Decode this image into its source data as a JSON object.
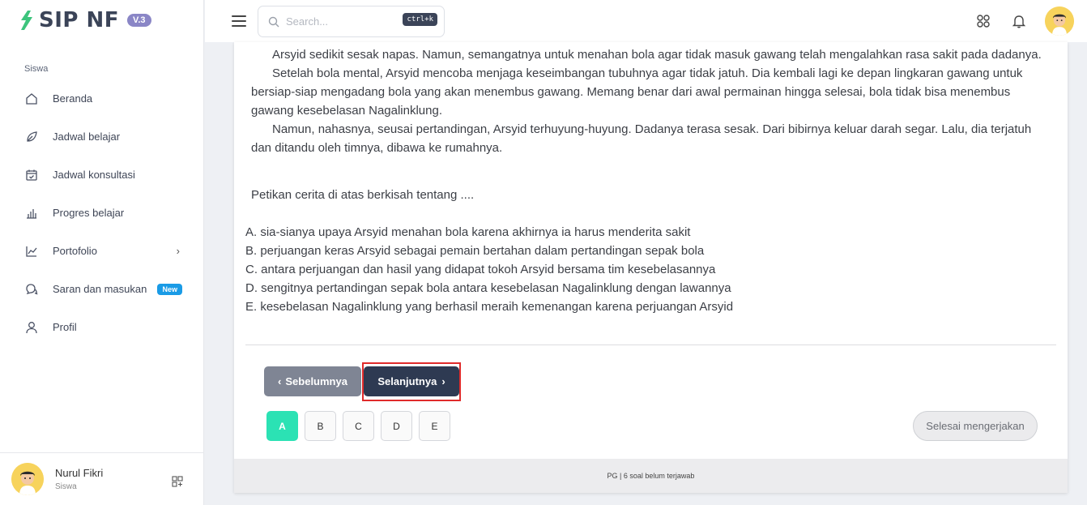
{
  "app": {
    "logo_text": "SIP NF",
    "version_badge": "V.3"
  },
  "sidebar": {
    "section_label": "Siswa",
    "items": [
      {
        "label": "Beranda",
        "icon": "home-icon"
      },
      {
        "label": "Jadwal belajar",
        "icon": "leaf-icon"
      },
      {
        "label": "Jadwal konsultasi",
        "icon": "calendar-check-icon"
      },
      {
        "label": "Progres belajar",
        "icon": "bar-chart-icon"
      },
      {
        "label": "Portofolio",
        "icon": "line-chart-icon",
        "chevron": "›"
      },
      {
        "label": "Saran dan masukan",
        "icon": "chat-icon",
        "badge": "New"
      },
      {
        "label": "Profil",
        "icon": "user-icon"
      }
    ],
    "user": {
      "name": "Nurul Fikri",
      "role": "Siswa"
    }
  },
  "header": {
    "search_placeholder": "Search...",
    "search_shortcut": "ctrl+k"
  },
  "passage": {
    "paragraphs": [
      "Arsyid sedikit sesak napas. Namun, semangatnya untuk menahan bola agar tidak masuk gawang telah mengalahkan rasa sakit pada dadanya.",
      "Setelah bola mental, Arsyid mencoba menjaga keseimbangan tubuhnya agar tidak jatuh. Dia kembali lagi ke depan lingkaran gawang untuk bersiap-siap mengadang bola yang akan menembus gawang. Memang benar dari awal permainan hingga selesai, bola tidak bisa menembus gawang kesebelasan Nagalinklung.",
      "Namun, nahasnya, seusai pertandingan, Arsyid terhuyung-huyung. Dadanya terasa sesak. Dari bibirnya keluar darah segar. Lalu, dia terjatuh dan ditandu oleh timnya, dibawa ke rumahnya."
    ]
  },
  "question": "Petikan cerita di atas berkisah tentang ....",
  "options": [
    "A. sia-sianya upaya Arsyid menahan bola karena akhirnya ia harus menderita sakit",
    "B. perjuangan keras Arsyid sebagai pemain bertahan dalam pertandingan sepak bola",
    "C. antara perjuangan dan hasil yang didapat tokoh Arsyid bersama tim kesebelasannya",
    "D. sengitnya pertandingan sepak bola antara kesebelasan Nagalinklung dengan lawannya",
    "E. kesebelasan Nagalinklung yang berhasil meraih kemenangan karena perjuangan Arsyid"
  ],
  "navigation": {
    "prev_label": "Sebelumnya",
    "next_label": "Selanjutnya"
  },
  "answer_buttons": [
    "A",
    "B",
    "C",
    "D",
    "E"
  ],
  "selected_answer": "A",
  "finish_label": "Selesai mengerjakan",
  "footer_status": "PG | 6 soal belum terjawab",
  "colors": {
    "active_answer": "#2be2b4",
    "next_button": "#2e3a52",
    "prev_button": "#7f8594",
    "highlight": "#e02b2b",
    "badge": "#1a9be6"
  }
}
